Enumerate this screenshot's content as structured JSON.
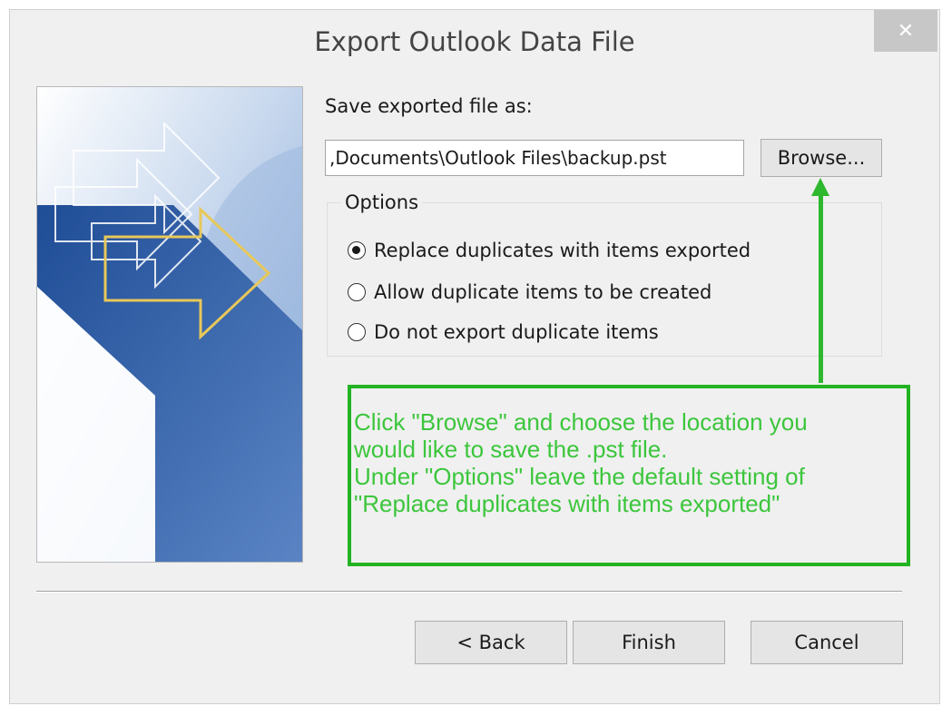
{
  "dialog": {
    "title": "Export Outlook Data File",
    "close_glyph": "✕"
  },
  "save": {
    "label": "Save exported file as:",
    "path_value": ",Documents\\Outlook Files\\backup.pst",
    "browse_label": "Browse..."
  },
  "options": {
    "legend": "Options",
    "items": [
      {
        "label": "Replace duplicates with items exported",
        "checked": true
      },
      {
        "label": "Allow duplicate items to be created",
        "checked": false
      },
      {
        "label": "Do not export duplicate items",
        "checked": false
      }
    ]
  },
  "annotation": {
    "lines": [
      "Click \"Browse\" and choose the location you",
      "would like to save the .pst file.",
      "Under \"Options\" leave the default setting of",
      "\"Replace duplicates with items exported\""
    ],
    "color": "#3cc63c",
    "border_color": "#22b322"
  },
  "footer": {
    "back_label": "< Back",
    "finish_label": "Finish",
    "cancel_label": "Cancel"
  },
  "icons": {
    "close": "close-icon",
    "wizard_art": "export-arrows-illustration"
  }
}
